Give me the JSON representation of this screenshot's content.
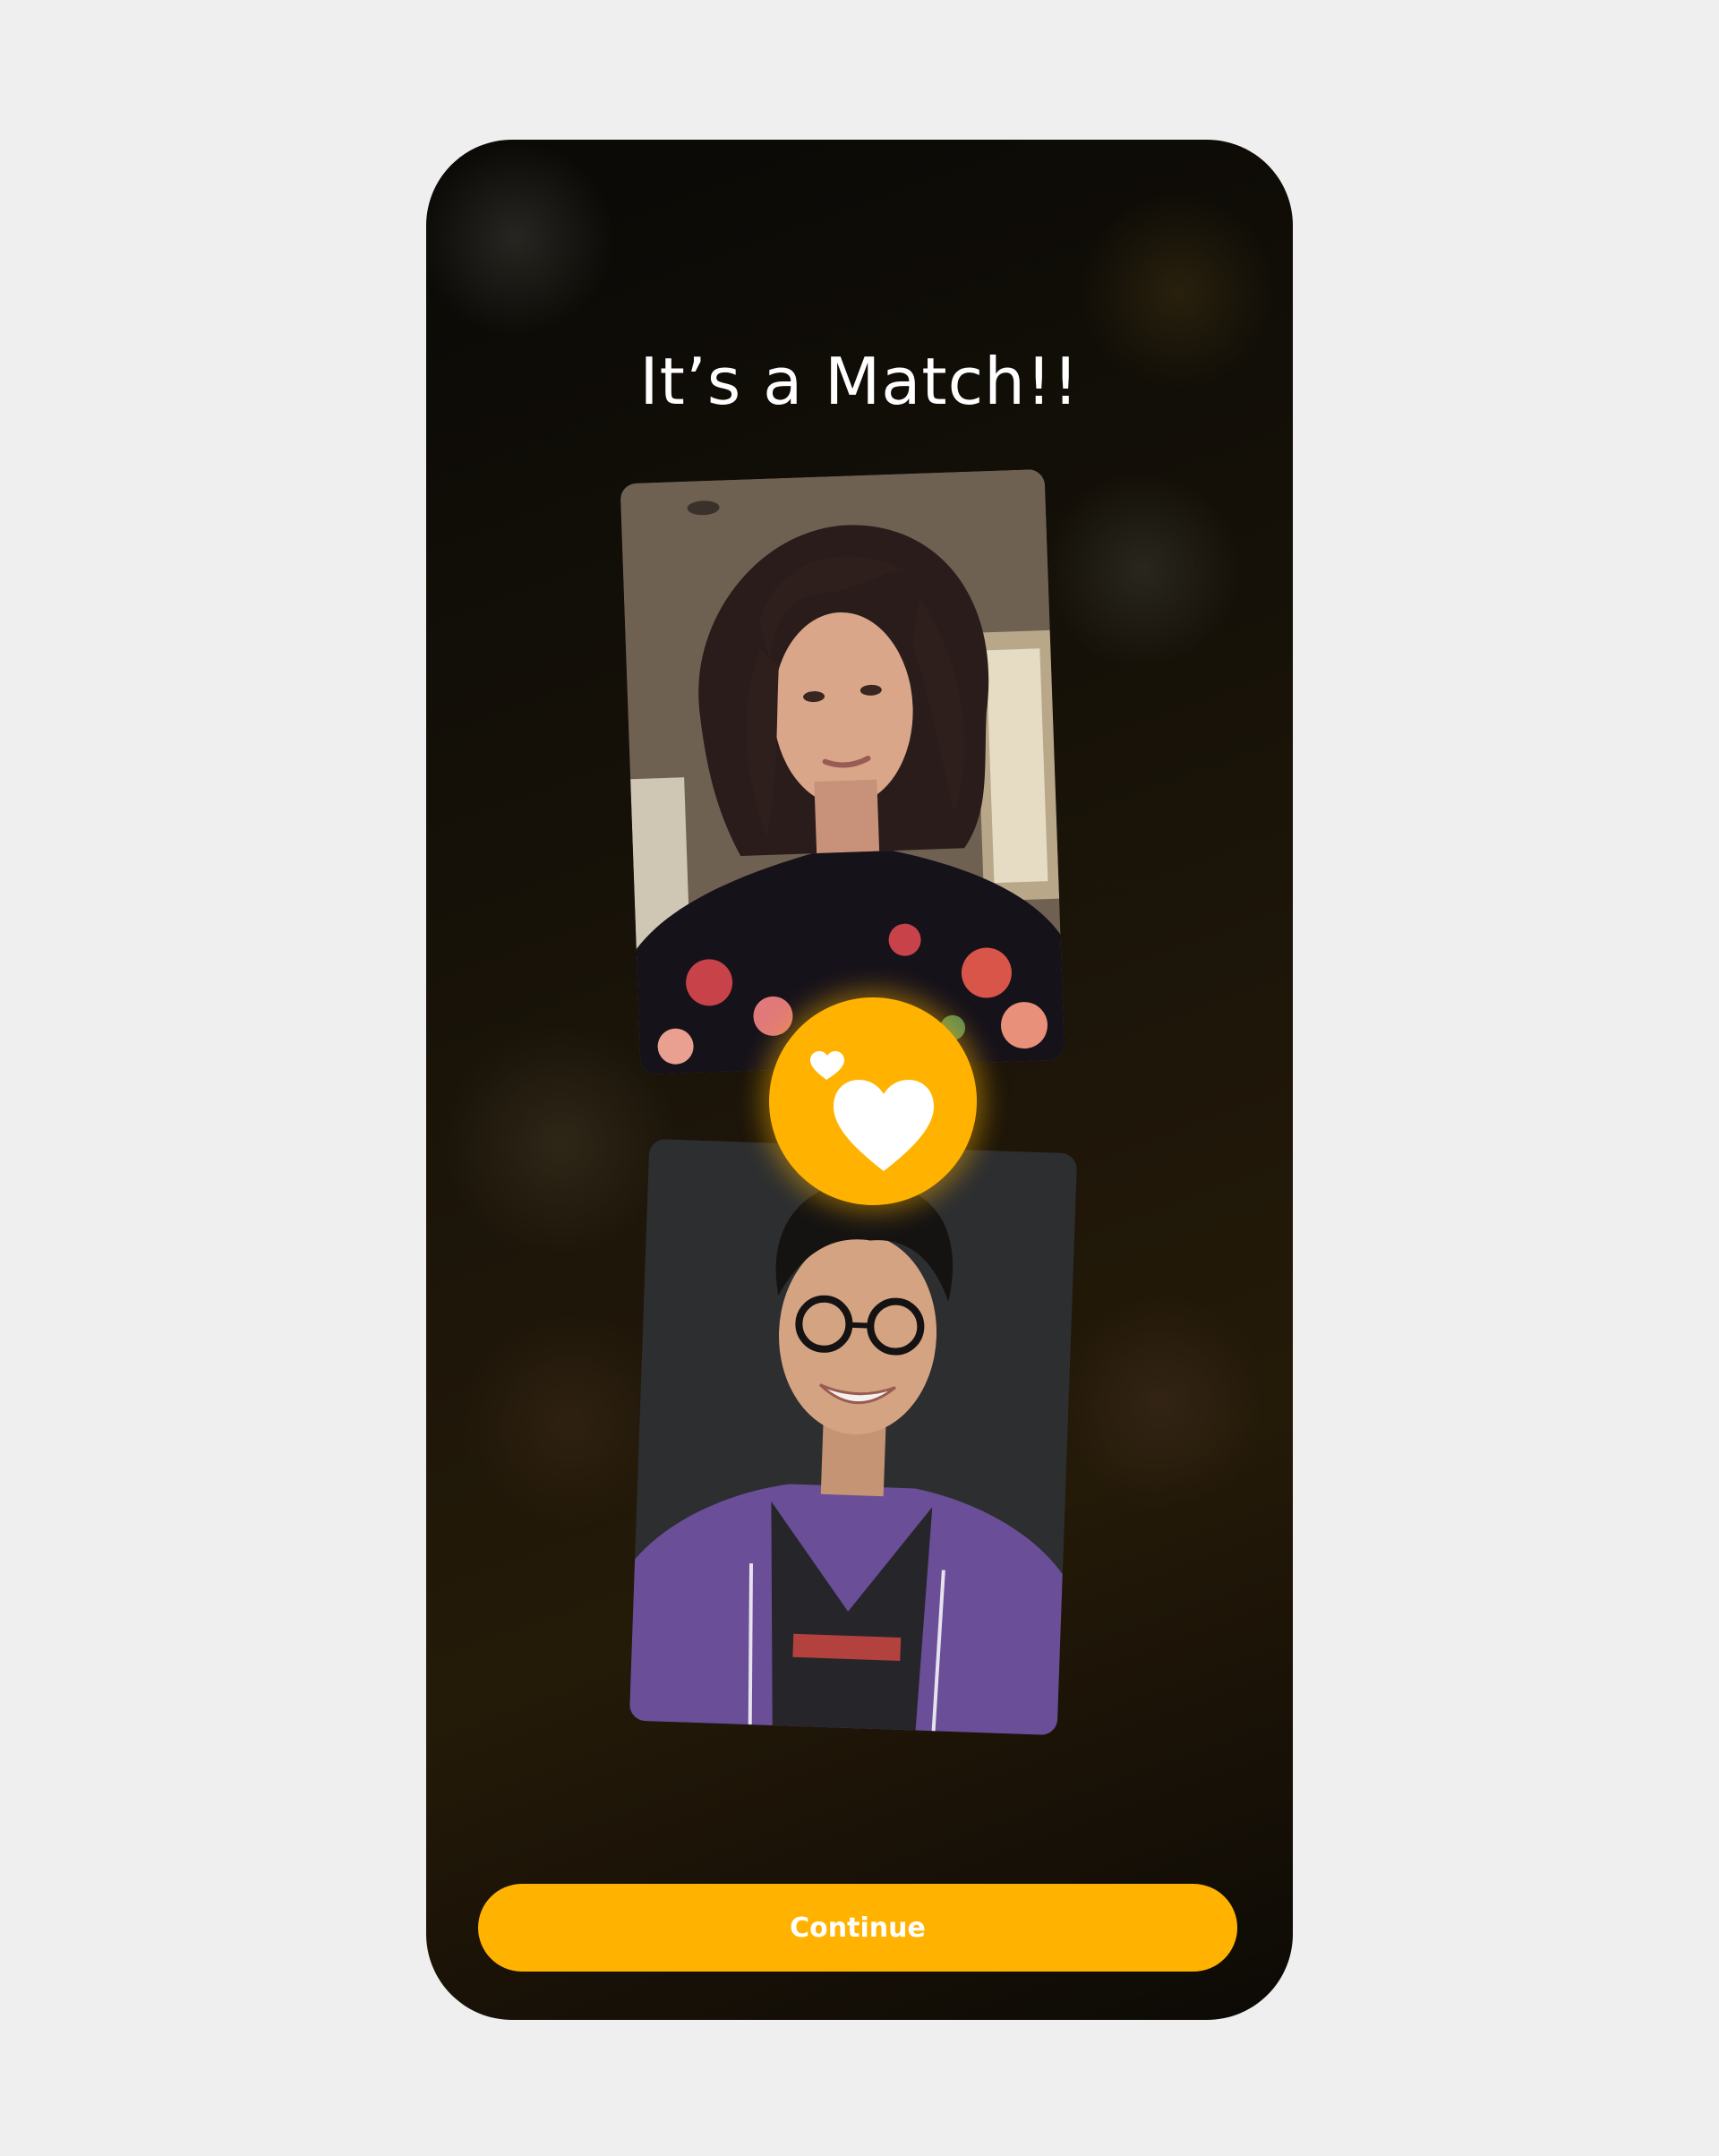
{
  "screen": {
    "title": "It’s a Match!!",
    "continue_label": "Continue"
  },
  "profiles": [
    {
      "photo": "woman-portrait-photo"
    },
    {
      "photo": "man-portrait-photo"
    }
  ],
  "badge": {
    "icon": "hearts-icon"
  },
  "colors": {
    "accent": "#ffb300",
    "page_background": "#efefef",
    "phone_background": "#1a1207",
    "text": "#ffffff"
  }
}
